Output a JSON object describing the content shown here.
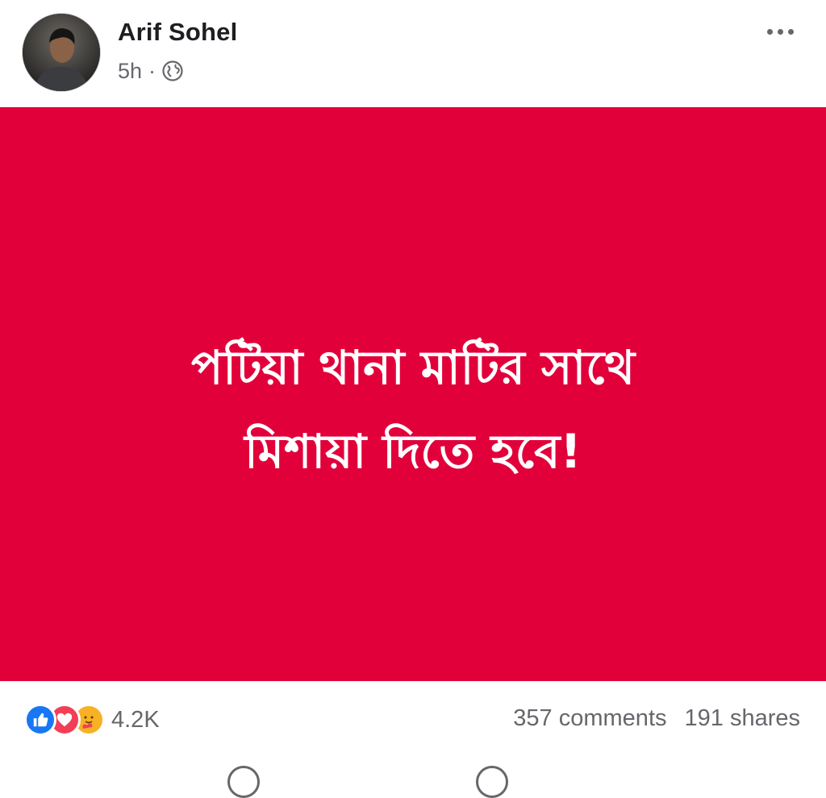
{
  "post": {
    "author": "Arif Sohel",
    "time": "5h",
    "separator": "·",
    "privacy_icon": "globe-icon",
    "more_icon": "more-options-icon",
    "image": {
      "background_color": "#e1003a",
      "text_color": "#ffffff",
      "lines": [
        "পটিয়া থানা মাটির সাথে",
        "মিশায়া দিতে হবে!"
      ]
    }
  },
  "engagement": {
    "reaction_icons": [
      "like-icon",
      "love-icon",
      "care-icon"
    ],
    "reaction_count": "4.2K",
    "comments": "357 comments",
    "shares": "191 shares"
  }
}
